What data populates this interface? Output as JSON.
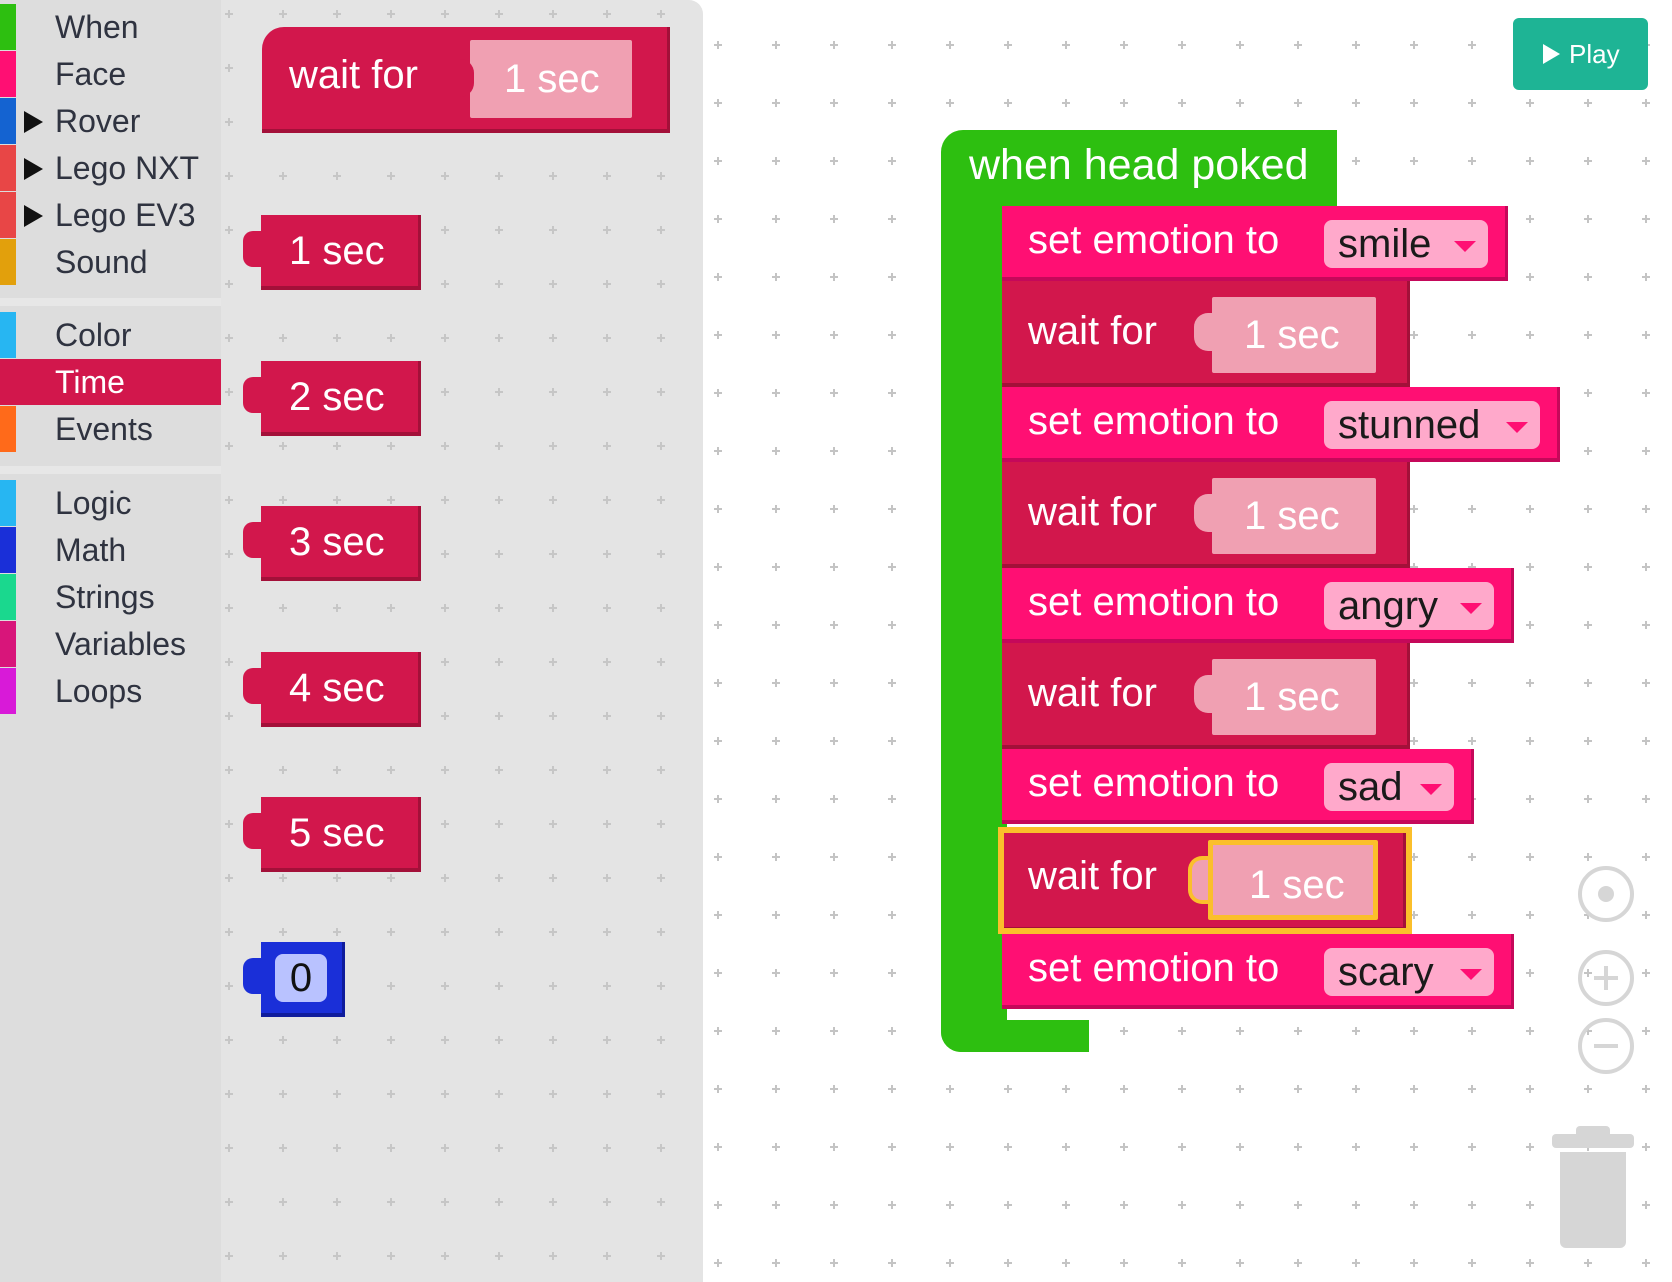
{
  "toolbox": {
    "categories": [
      {
        "label": "When",
        "color": "#2dbf10",
        "expandable": false
      },
      {
        "label": "Face",
        "color": "#ff0f73",
        "expandable": false
      },
      {
        "label": "Rover",
        "color": "#1463d1",
        "expandable": true
      },
      {
        "label": "Lego NXT",
        "color": "#e84646",
        "expandable": true
      },
      {
        "label": "Lego EV3",
        "color": "#e84646",
        "expandable": true
      },
      {
        "label": "Sound",
        "color": "#e2a00c",
        "expandable": false
      },
      {
        "label": "Color",
        "color": "#27b6f2",
        "expandable": false
      },
      {
        "label": "Time",
        "color": "#d2174c",
        "expandable": false,
        "selected": true
      },
      {
        "label": "Events",
        "color": "#ff6a1a",
        "expandable": false
      },
      {
        "label": "Logic",
        "color": "#27b6f2",
        "expandable": false
      },
      {
        "label": "Math",
        "color": "#1a2fd8",
        "expandable": false
      },
      {
        "label": "Strings",
        "color": "#1ad88e",
        "expandable": false
      },
      {
        "label": "Variables",
        "color": "#d8157a",
        "expandable": false
      },
      {
        "label": "Loops",
        "color": "#d81ad8",
        "expandable": false
      }
    ]
  },
  "flyout": {
    "wait_block": {
      "label": "wait for",
      "value": "1 sec"
    },
    "durations": [
      "1 sec",
      "2 sec",
      "3 sec",
      "4 sec",
      "5 sec"
    ],
    "number_block": "0"
  },
  "workspace": {
    "event_label": "when head poked",
    "stack": [
      {
        "type": "emotion",
        "label": "set emotion to",
        "value": "smile"
      },
      {
        "type": "wait",
        "label": "wait for",
        "value": "1 sec"
      },
      {
        "type": "emotion",
        "label": "set emotion to",
        "value": "stunned"
      },
      {
        "type": "wait",
        "label": "wait for",
        "value": "1 sec"
      },
      {
        "type": "emotion",
        "label": "set emotion to",
        "value": "angry"
      },
      {
        "type": "wait",
        "label": "wait for",
        "value": "1 sec"
      },
      {
        "type": "emotion",
        "label": "set emotion to",
        "value": "sad"
      },
      {
        "type": "wait",
        "label": "wait for",
        "value": "1 sec",
        "selected": true
      },
      {
        "type": "emotion",
        "label": "set emotion to",
        "value": "scary"
      }
    ]
  },
  "controls": {
    "play_label": "Play",
    "play_color": "#1eb495",
    "icons": [
      "recenter-icon",
      "zoom-in-icon",
      "zoom-out-icon",
      "trash-icon"
    ]
  }
}
